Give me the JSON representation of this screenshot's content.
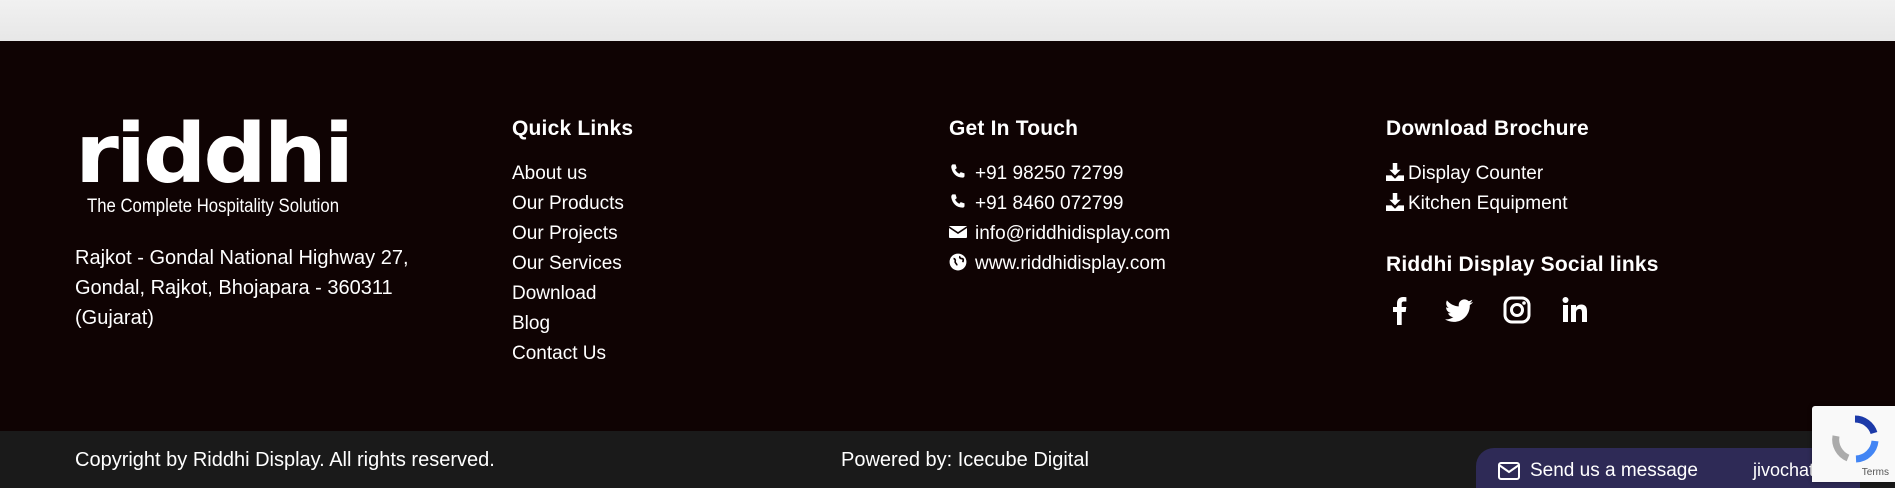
{
  "logo": {
    "name": "riddhi",
    "tagline": "The Complete Hospitality Solution"
  },
  "address": "Rajkot - Gondal National Highway 27, Gondal, Rajkot, Bhojapara - 360311 (Gujarat)",
  "quick_links": {
    "title": "Quick Links",
    "items": [
      "About us",
      "Our Products",
      "Our Projects",
      "Our Services",
      "Download",
      "Blog",
      "Contact Us"
    ]
  },
  "contact": {
    "title": "Get In Touch",
    "phone1": "+91 98250 72799",
    "phone2": "+91 8460 072799",
    "email": "info@riddhidisplay.com",
    "website": "www.riddhidisplay.com"
  },
  "brochure": {
    "title": "Download Brochure",
    "items": [
      "Display Counter",
      "Kitchen Equipment"
    ],
    "social_title": "Riddhi Display Social links",
    "social_icons": [
      "facebook-icon",
      "twitter-icon",
      "instagram-icon",
      "linkedin-icon"
    ]
  },
  "bottom": {
    "copyright": "Copyright by Riddhi Display. All rights reserved.",
    "powered": "Powered by: Icecube Digital"
  },
  "chat": {
    "message": "Send us a message",
    "brand": "jivochat"
  },
  "recaptcha": {
    "terms": "Terms"
  },
  "colors": {
    "footer_bg": "#0f0303",
    "bottom_bg": "#1a1a1a",
    "chat_bg": "#2e2a56",
    "text": "#ffffff"
  }
}
